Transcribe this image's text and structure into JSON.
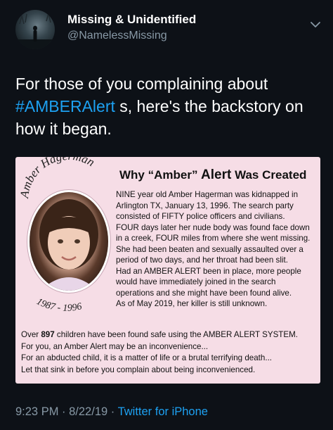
{
  "author": {
    "display_name": "Missing & Unidentified",
    "handle": "@NamelessMissing"
  },
  "tweet": {
    "text_part1": "For those of you complaining about",
    "hashtag": "#AMBERAlert",
    "text_part2": " s, here's the backstory on how it began."
  },
  "card": {
    "arc_name": "Amber Hagerman",
    "years": "1987 - 1996",
    "title_pre": "Why “Amber”",
    "title_mid": " Alert",
    "title_post": " Was Created",
    "story": [
      "NINE year old Amber Hagerman was kidnapped in Arlington TX, January 13, 1996.  The search party consisted of FIFTY police officers and civilians.",
      "FOUR days later her nude body was found face down in a creek, FOUR miles from where she went missing.  She had been beaten and sexually assaulted over a period of two days, and her throat had been slit.",
      "Had an AMBER ALERT been in place, more people would have immediately joined in the search operations and she might have been found alive.",
      "As of May 2019, her killer is still unknown."
    ],
    "bottom_pre": "Over ",
    "bottom_number": "897",
    "bottom_post": " children have been found safe using the AMBER ALERT SYSTEM.",
    "bottom_lines": [
      "For you, an Amber Alert may be an inconvenience...",
      "For an abducted child, it is a matter of life or a brutal terrifying death...",
      "Let that sink in before you complain about being inconvenienced."
    ]
  },
  "meta": {
    "time": "9:23 PM",
    "separator1": " · ",
    "date": "8/22/19",
    "separator2": " · ",
    "source": "Twitter for iPhone"
  },
  "colors": {
    "background": "#0d1117",
    "link": "#1da1f2",
    "muted": "#8899a6",
    "card": "#f6dde6"
  }
}
